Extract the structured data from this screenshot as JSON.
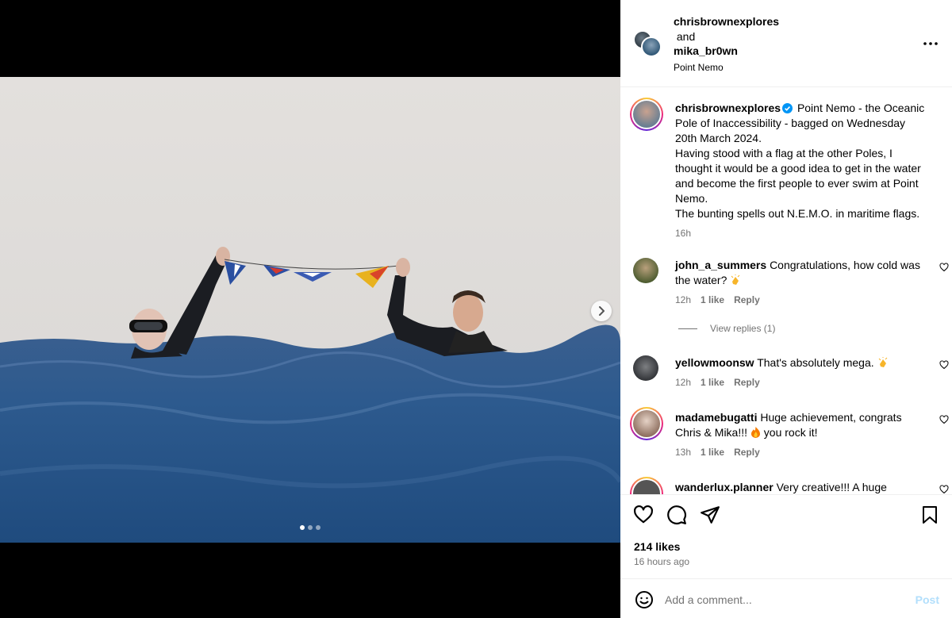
{
  "header": {
    "user1": "chrisbrownexplores",
    "and_text": "and",
    "user2": "mika_br0wn",
    "location": "Point Nemo",
    "more_icon": "more-horizontal-icon"
  },
  "caption": {
    "username": "chrisbrownexplores",
    "line1": "Point Nemo - the Oceanic Pole of Inaccessibility - bagged on Wednesday 20th March 2024.",
    "line2": "Having stood with a flag at the other Poles, I thought it would be a good idea to get in the water and become the first people to ever swim at Point Nemo.",
    "line3": "The bunting spells out N.E.M.O. in maritime flags.",
    "time": "16h"
  },
  "comments": [
    {
      "username": "john_a_summers",
      "text": "Congratulations, how cold was the water?",
      "time": "12h",
      "likes": "1 like",
      "reply": "Reply"
    },
    {
      "username": "yellowmoonsw",
      "text": "That's absolutely mega.",
      "time": "12h",
      "likes": "1 like",
      "reply": "Reply"
    },
    {
      "username": "madamebugatti",
      "text_a": "Huge achievement, congrats Chris & Mika!!!",
      "text_b": "you rock it!",
      "time": "13h",
      "likes": "1 like",
      "reply": "Reply"
    },
    {
      "username": "wanderlux.planner",
      "text": "Very creative!!! A huge"
    }
  ],
  "view_replies": "View replies (1)",
  "actions": {
    "likes": "214 likes",
    "time_ago": "16 hours ago"
  },
  "add_comment": {
    "placeholder": "Add a comment...",
    "post_label": "Post"
  },
  "carousel": {
    "count": 3,
    "active": 0
  },
  "colors": {
    "link_blue": "#0095f6",
    "post_disabled": "#b2dffc",
    "muted": "#737373",
    "verified": "#0095f6"
  }
}
